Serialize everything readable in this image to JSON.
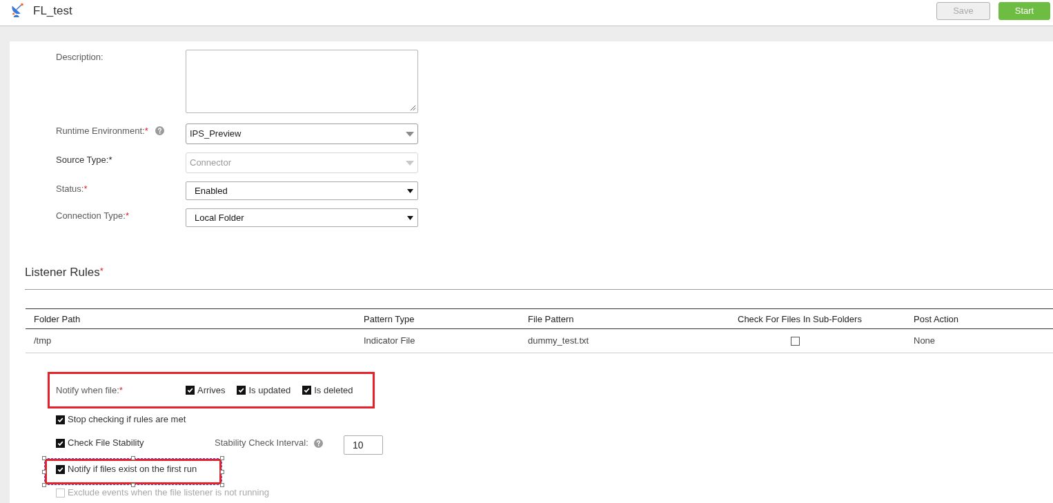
{
  "header": {
    "title": "FL_test",
    "buttons": [
      {
        "label": "Save",
        "kind": "secondary",
        "disabled": true
      },
      {
        "label": "Start",
        "kind": "primary",
        "disabled": false
      }
    ]
  },
  "fields": [
    {
      "kind": "textarea",
      "label": "Description:"
    },
    {
      "kind": "combobox",
      "label": "Runtime Environment:",
      "required_mark": "*",
      "help": true,
      "value": "IPS_Preview",
      "disabled": false
    },
    {
      "kind": "combobox",
      "label": "Source Type:",
      "required_mark": "*",
      "value": "Connector",
      "disabled": true
    },
    {
      "kind": "select",
      "label": "Status:",
      "required_mark": "*",
      "value": "Enabled",
      "disabled": false
    },
    {
      "kind": "select",
      "label": "Connection Type:",
      "required_mark": "*",
      "value": "Local Folder",
      "disabled": false
    }
  ],
  "listener_rules": {
    "title": "Listener Rules",
    "required_mark": "*",
    "table": {
      "columns": [
        "Folder Path",
        "Pattern Type",
        "File Pattern",
        "Check For Files In Sub-Folders",
        "Post Action"
      ],
      "rows": [
        {
          "cells": [
            {
              "kind": "text",
              "text": "/tmp"
            },
            {
              "kind": "text",
              "text": "Indicator File"
            },
            {
              "kind": "text",
              "text": "dummy_test.txt"
            },
            {
              "kind": "checkbox",
              "checked": false
            },
            {
              "kind": "text",
              "text": "None"
            }
          ]
        }
      ]
    }
  },
  "notify_when": {
    "label": "Notify when file:",
    "required_mark": "*",
    "highlighted": true,
    "options": [
      {
        "label": "Arrives",
        "checked": true
      },
      {
        "label": "Is updated",
        "checked": true
      },
      {
        "label": "Is deleted",
        "checked": true
      }
    ]
  },
  "options": [
    {
      "kind": "checkbox",
      "label": "Stop checking if rules are met",
      "checked": true,
      "disabled": false
    },
    {
      "kind": "checkbox_with_interval",
      "label": "Check File Stability",
      "checked": true,
      "disabled": false,
      "interval": {
        "label": "Stability Check Interval:",
        "help": true,
        "value": "10"
      }
    },
    {
      "kind": "checkbox",
      "label": "Notify if files exist on the first run",
      "checked": true,
      "disabled": false,
      "highlighted": true,
      "handles": true
    },
    {
      "kind": "checkbox",
      "label": "Exclude events when the file listener is not running",
      "checked": false,
      "disabled": true
    }
  ]
}
